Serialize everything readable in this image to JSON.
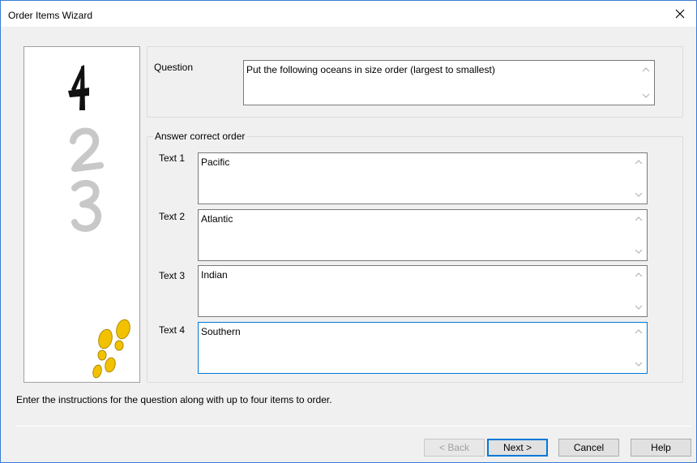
{
  "window": {
    "title": "Order Items Wizard",
    "close_glyph": "✕"
  },
  "question": {
    "label": "Question",
    "value": "Put the following oceans in size order (largest to smallest)"
  },
  "answers": {
    "group_label": "Answer correct order",
    "items": [
      {
        "label": "Text 1",
        "value": "Pacific"
      },
      {
        "label": "Text 2",
        "value": "Atlantic"
      },
      {
        "label": "Text 3",
        "value": "Indian"
      },
      {
        "label": "Text 4",
        "value": "Southern"
      }
    ]
  },
  "illustration": {
    "digits": [
      "1",
      "2",
      "3"
    ],
    "icons": [
      "numbers-icon",
      "footprints-icon"
    ],
    "colors": {
      "first": "#111111",
      "others": "#c8c8c8",
      "feet": "#f2c200"
    }
  },
  "instructions": "Enter the instructions for the question along with up to four items to order.",
  "buttons": {
    "back": "< Back",
    "next": "Next >",
    "cancel": "Cancel",
    "help": "Help"
  }
}
